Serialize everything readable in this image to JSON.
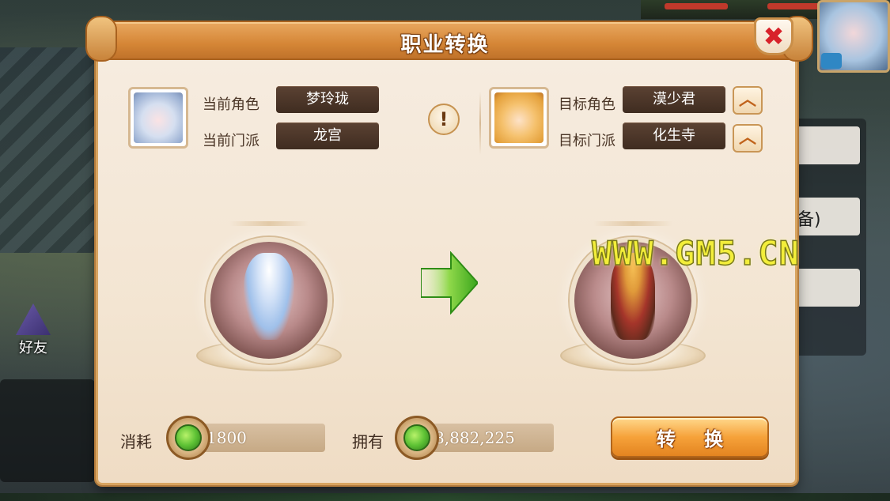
{
  "title": "职业转换",
  "current": {
    "role_label": "当前角色",
    "role_value": "梦玲珑",
    "school_label": "当前门派",
    "school_value": "龙宫"
  },
  "target": {
    "role_label": "目标角色",
    "role_value": "漠少君",
    "school_label": "目标门派",
    "school_value": "化生寺"
  },
  "info_symbol": "!",
  "close_symbol": "✖",
  "arrow_up_symbol": "︿",
  "cost": {
    "label": "消耗",
    "value": "1800"
  },
  "owned": {
    "label": "拥有",
    "value": "8,882,225"
  },
  "convert_button": "转 换",
  "watermark": "WWW.GM5.CN",
  "background": {
    "friend_label": "好友",
    "avatar_level": "",
    "side_text": "备)"
  },
  "colors": {
    "panel_bg": "#f3e5d2",
    "title_bar": "#d58636",
    "value_box": "#4a3526",
    "button": "#f6a23a",
    "close_x": "#d8222a"
  }
}
